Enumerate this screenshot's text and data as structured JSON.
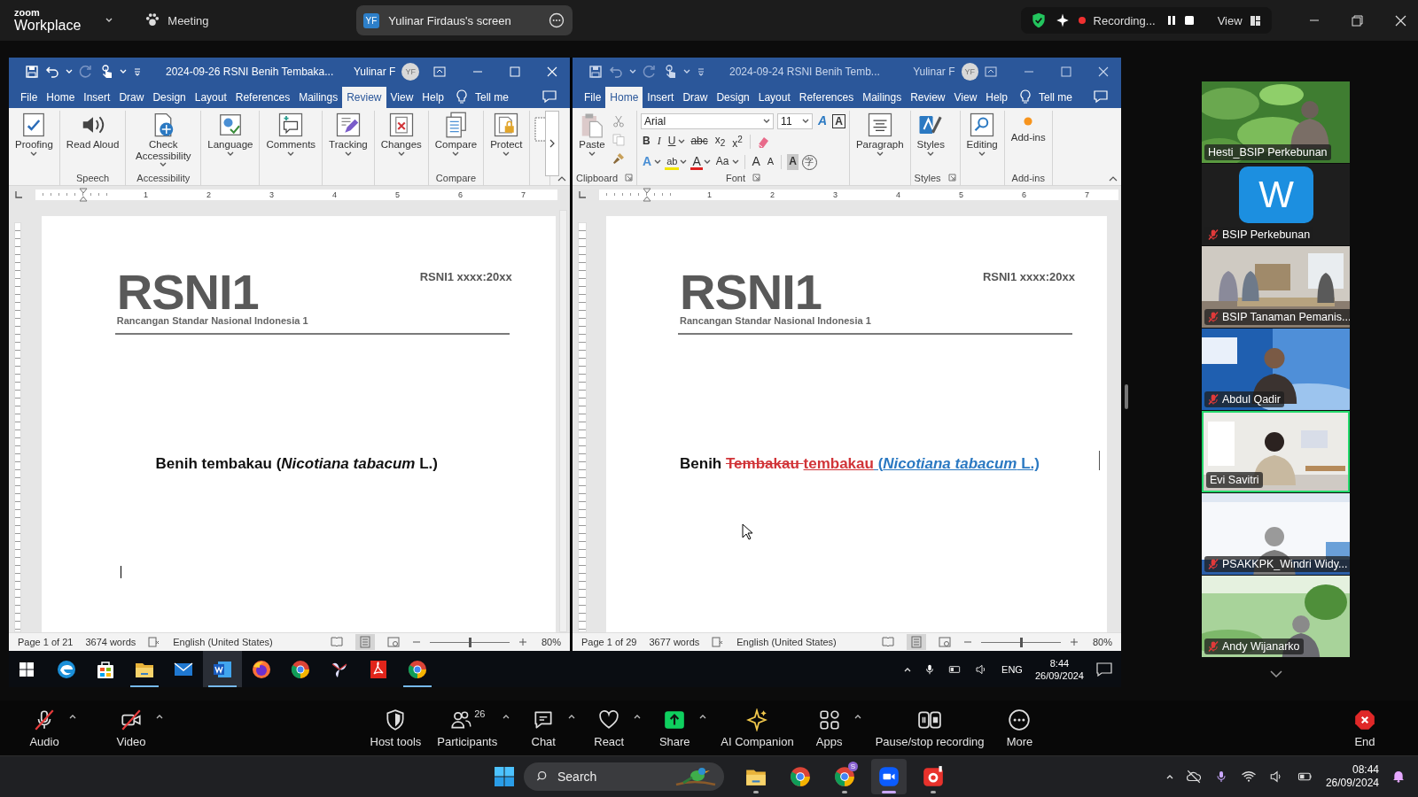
{
  "top_bar": {
    "brand_small": "zoom",
    "brand": "Workplace",
    "meeting_label": "Meeting",
    "share_pill": {
      "initials": "YF",
      "title": "Yulinar Firdaus's screen"
    },
    "recording_label": "Recording...",
    "view_label": "View"
  },
  "shared_screen": {
    "windows": [
      {
        "active": true,
        "title": "2024-09-26 RSNI Benih Tembaka...",
        "user": "Yulinar F",
        "initials": "YF",
        "tabs": [
          {
            "label": "File",
            "selected": false
          },
          {
            "label": "Home",
            "selected": false
          },
          {
            "label": "Insert",
            "selected": false
          },
          {
            "label": "Draw",
            "selected": false
          },
          {
            "label": "Design",
            "selected": false
          },
          {
            "label": "Layout",
            "selected": false
          },
          {
            "label": "References",
            "selected": false
          },
          {
            "label": "Mailings",
            "selected": false
          },
          {
            "label": "Review",
            "selected": true
          },
          {
            "label": "View",
            "selected": false
          },
          {
            "label": "Help",
            "selected": false
          }
        ],
        "tell_me": "Tell me",
        "ribbon": {
          "scroll_right": true,
          "groups": [
            {
              "kind": "buttons",
              "items": [
                {
                  "kind": "proofing",
                  "label": "Proofing",
                  "caret": true
                }
              ]
            },
            {
              "kind": "buttons",
              "label": "Speech",
              "items": [
                {
                  "kind": "read-aloud",
                  "label": "Read Aloud",
                  "caret": false
                }
              ]
            },
            {
              "kind": "buttons",
              "label": "Accessibility",
              "items": [
                {
                  "kind": "accessibility",
                  "label": "Check Accessibility",
                  "caret": true
                }
              ]
            },
            {
              "kind": "buttons",
              "items": [
                {
                  "kind": "language",
                  "label": "Language",
                  "caret": true
                }
              ]
            },
            {
              "kind": "buttons",
              "items": [
                {
                  "kind": "comments",
                  "label": "Comments",
                  "caret": true
                }
              ]
            },
            {
              "kind": "buttons",
              "items": [
                {
                  "kind": "tracking",
                  "label": "Tracking",
                  "caret": true
                }
              ]
            },
            {
              "kind": "buttons",
              "items": [
                {
                  "kind": "changes",
                  "label": "Changes",
                  "caret": true
                }
              ]
            },
            {
              "kind": "buttons",
              "label": "Compare",
              "items": [
                {
                  "kind": "compare",
                  "label": "Compare",
                  "caret": true
                }
              ]
            },
            {
              "kind": "buttons",
              "items": [
                {
                  "kind": "protect",
                  "label": "Protect",
                  "caret": true
                }
              ]
            },
            {
              "kind": "cut-off"
            }
          ]
        },
        "ruler_numbers": [
          "1",
          "2",
          "3",
          "4",
          "5",
          "6",
          "7"
        ],
        "document": {
          "header": "RSNI1 xxxx:20xx",
          "logo": "RSNI1",
          "subtitle": "Rancangan Standar  Nasional Indonesia 1",
          "title": [
            {
              "kind": "plain",
              "text": "Benih tembakau (*Nicotiana tabacum* L.)"
            }
          ],
          "text_cursor": true
        },
        "status": {
          "page": "Page 1 of 21",
          "words": "3674 words",
          "language": "English (United States)",
          "views": [
            {
              "kind": "read",
              "selected": false
            },
            {
              "kind": "print",
              "selected": true
            },
            {
              "kind": "web",
              "selected": false
            }
          ],
          "level": 0.5,
          "zoom": "80%"
        }
      },
      {
        "active": false,
        "title": "2024-09-24 RSNI Benih Temb...",
        "user": "Yulinar F",
        "initials": "YF",
        "tabs": [
          {
            "label": "File",
            "selected": false
          },
          {
            "label": "Home",
            "selected": true
          },
          {
            "label": "Insert",
            "selected": false
          },
          {
            "label": "Draw",
            "selected": false
          },
          {
            "label": "Design",
            "selected": false
          },
          {
            "label": "Layout",
            "selected": false
          },
          {
            "label": "References",
            "selected": false
          },
          {
            "label": "Mailings",
            "selected": false
          },
          {
            "label": "Review",
            "selected": false
          },
          {
            "label": "View",
            "selected": false
          },
          {
            "label": "Help",
            "selected": false
          }
        ],
        "tell_me": "Tell me",
        "ribbon": {
          "groups": [
            {
              "kind": "clipboard",
              "label": "Clipboard",
              "launcher": true,
              "items": [
                {
                  "kind": "paste",
                  "label": "Paste",
                  "caret": true
                }
              ],
              "tools": [
                {
                  "kind": "cut"
                },
                {
                  "kind": "copy"
                },
                {
                  "kind": "painter"
                }
              ]
            },
            {
              "kind": "font",
              "label": "Font",
              "launcher": true,
              "font_name": "Arial",
              "font_size": "11",
              "top_tools": [
                {
                  "text": "A",
                  "kind": "clear"
                },
                {
                  "text": "A",
                  "kind": "boxed"
                }
              ],
              "row1": [
                {
                  "text": "B",
                  "kind": "bold",
                  "caret": false
                },
                {
                  "text": "I",
                  "kind": "italic",
                  "caret": false
                },
                {
                  "text": "U",
                  "kind": "underline",
                  "caret": true
                },
                {
                  "text": "abc",
                  "kind": "strike",
                  "caret": false
                },
                {
                  "text": "x$_{2}$",
                  "kind": "plain",
                  "caret": false
                },
                {
                  "text": "x$^{2}$",
                  "kind": "plain",
                  "caret": false
                }
              ],
              "row2": [
                {
                  "text": "A",
                  "kind": "effects",
                  "caret": true
                },
                {
                  "text": "ab",
                  "kind": "highlight",
                  "color": "#f2e600",
                  "caret": true
                },
                {
                  "text": "A",
                  "kind": "color",
                  "color": "#e02020",
                  "caret": true
                },
                {
                  "text": "Aa",
                  "kind": "plain",
                  "caret": true
                },
                {
                  "text": "A",
                  "kind": "grow",
                  "caret": false
                },
                {
                  "text": "A",
                  "kind": "shrink",
                  "caret": false
                },
                {
                  "text": "A",
                  "kind": "shade",
                  "caret": false
                },
                {
                  "text": "字",
                  "kind": "enclose",
                  "caret": false
                }
              ]
            },
            {
              "kind": "buttons",
              "items": [
                {
                  "kind": "paragraph",
                  "label": "Paragraph",
                  "caret": true
                }
              ]
            },
            {
              "kind": "buttons",
              "label": "Styles",
              "launcher": true,
              "items": [
                {
                  "kind": "styles",
                  "label": "Styles",
                  "caret": true
                }
              ]
            },
            {
              "kind": "buttons",
              "items": [
                {
                  "kind": "editing",
                  "label": "Editing",
                  "caret": true
                }
              ]
            },
            {
              "kind": "buttons",
              "label": "Add-ins",
              "items": [
                {
                  "kind": "addins",
                  "label": "Add-ins",
                  "caret": false
                }
              ]
            }
          ]
        },
        "ruler_numbers": [
          "1",
          "2",
          "3",
          "4",
          "5",
          "6",
          "7"
        ],
        "document": {
          "header": "RSNI1 xxxx:20xx",
          "logo": "RSNI1",
          "subtitle": "Rancangan Standar  Nasional Indonesia 1",
          "title": [
            {
              "kind": "plain",
              "text": "Benih "
            },
            {
              "kind": "deleted",
              "text": "Tembakau "
            },
            {
              "kind": "inserted",
              "text": "tembakau"
            },
            {
              "kind": "moved",
              "text": " (*Nicotiana tabacum* L.)"
            }
          ],
          "change_bar": true,
          "mouse_pointer": true
        },
        "status": {
          "page": "Page 1 of 29",
          "words": "3677 words",
          "language": "English (United States)",
          "views": [
            {
              "kind": "read",
              "selected": false
            },
            {
              "kind": "print",
              "selected": true
            },
            {
              "kind": "web",
              "selected": false
            }
          ],
          "level": 0.5,
          "zoom": "80%"
        }
      }
    ],
    "taskbar": {
      "apps": [
        {
          "kind": "edge",
          "running": false,
          "active": false
        },
        {
          "kind": "store",
          "running": false,
          "active": false
        },
        {
          "kind": "explorer",
          "running": true,
          "active": false
        },
        {
          "kind": "mail",
          "running": false,
          "active": false
        },
        {
          "kind": "word",
          "running": true,
          "active": true
        },
        {
          "kind": "firefox",
          "running": false,
          "active": false
        },
        {
          "kind": "chrome",
          "running": false,
          "active": false
        },
        {
          "kind": "pinwheel",
          "running": false,
          "active": false
        },
        {
          "kind": "acrobat",
          "running": false,
          "active": false
        },
        {
          "kind": "chrome",
          "running": true,
          "active": false
        }
      ],
      "language": "ENG",
      "time": "8:44",
      "date": "26/09/2024"
    }
  },
  "gallery": [
    {
      "kind": "picture",
      "name": "Hesti_BSIP Perkebunan",
      "muted": false,
      "speaking": false
    },
    {
      "kind": "avatar",
      "letter": "W",
      "name": "BSIP Perkebunan",
      "muted": true,
      "speaking": false
    },
    {
      "kind": "picture",
      "name": "BSIP Tanaman Pemanis...",
      "muted": true,
      "speaking": false
    },
    {
      "kind": "picture",
      "name": "Abdul Qadir",
      "muted": true,
      "speaking": false
    },
    {
      "kind": "picture",
      "name": "Evi Savitri",
      "muted": false,
      "speaking": true
    },
    {
      "kind": "picture",
      "name": "PSAKKPK_Windri Widy...",
      "muted": true,
      "speaking": false
    },
    {
      "kind": "picture",
      "name": "Andy Wijanarko",
      "muted": true,
      "speaking": false
    }
  ],
  "toolbar": [
    {
      "kind": "audio",
      "label": "Audio",
      "off": true,
      "caret": true
    },
    {
      "kind": "video",
      "label": "Video",
      "off": true,
      "caret": true
    },
    {
      "kind": "host",
      "label": "Host tools",
      "off": false,
      "caret": false
    },
    {
      "kind": "participants",
      "label": "Participants",
      "count": "26",
      "off": false,
      "caret": true
    },
    {
      "kind": "chat",
      "label": "Chat",
      "off": false,
      "caret": true
    },
    {
      "kind": "react",
      "label": "React",
      "off": false,
      "caret": true
    },
    {
      "kind": "share",
      "label": "Share",
      "off": false,
      "caret": true
    },
    {
      "kind": "ai",
      "label": "AI Companion",
      "off": false,
      "caret": false
    },
    {
      "kind": "apps",
      "label": "Apps",
      "off": false,
      "caret": true
    },
    {
      "kind": "record",
      "label": "Pause/stop recording",
      "off": false,
      "caret": false
    },
    {
      "kind": "more",
      "label": "More",
      "off": false,
      "caret": false
    },
    {
      "kind": "end",
      "label": "End",
      "off": false,
      "caret": false
    }
  ],
  "taskbar": {
    "search_placeholder": "Search",
    "apps": [
      {
        "kind": "explorer",
        "running": true,
        "active": false
      },
      {
        "kind": "chrome",
        "running": false,
        "active": false
      },
      {
        "kind": "chrome-profile",
        "badge": "S",
        "running": true,
        "active": false
      },
      {
        "kind": "zoom",
        "running": true,
        "active": true
      },
      {
        "kind": "camera",
        "running": true,
        "active": false
      }
    ],
    "time": "08:44",
    "date": "26/09/2024"
  }
}
